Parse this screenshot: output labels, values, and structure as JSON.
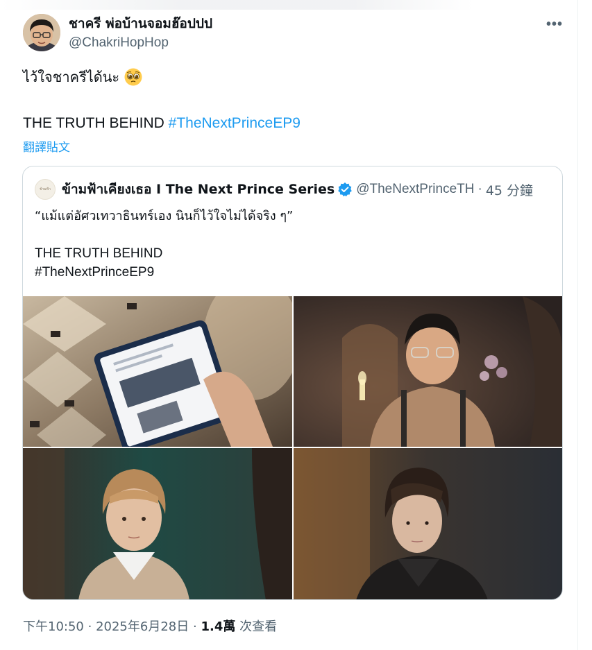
{
  "tweet": {
    "display_name": "ชาครี พ่อบ้านจอมฮ๊อปปป",
    "handle": "@ChakriHopHop",
    "more_icon": "more-horizontal-icon",
    "text_line1": "ไว้ใจชาครีได้นะ",
    "emoji": "pleading-face-emoji",
    "text_line2": "THE TRUTH BEHIND",
    "hashtag": "#TheNextPrinceEP9",
    "translate_label": "翻譯貼文"
  },
  "quoted_tweet": {
    "avatar_text": "ข้ามฟ้า",
    "display_name": "ข้ามฟ้าเคียงเธอ I The Next Prince Series",
    "verified_icon": "verified-badge-icon",
    "handle": "@TheNextPrinceTH",
    "separator": "·",
    "time": "45 分鐘",
    "quote_text": "“แม้แต่อัศวเทวาธินทร์เอง นินก็ไว้ใจไม่ได้จริง ๆ”",
    "line2": "THE TRUTH BEHIND",
    "line3": "#TheNextPrinceEP9"
  },
  "meta": {
    "time": "下午10:50",
    "sep1": "·",
    "date": "2025年6月28日",
    "sep2": "·",
    "views_count": "1.4萬",
    "views_label": "次查看"
  },
  "colors": {
    "link": "#1d9bf0",
    "secondary_text": "#536471",
    "primary_text": "#0f1419",
    "border": "#cfd9de"
  }
}
